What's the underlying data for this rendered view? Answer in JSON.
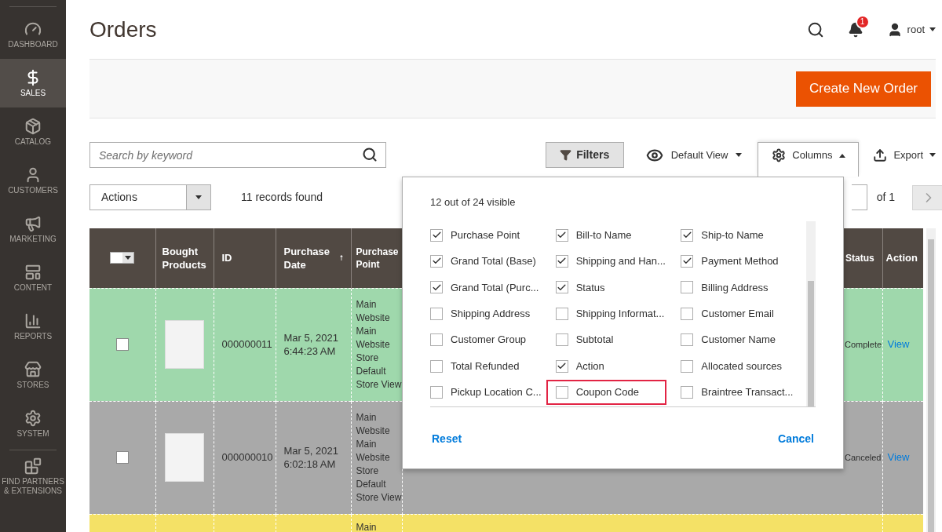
{
  "sidebar": {
    "items": [
      {
        "label": "DASHBOARD",
        "selected": false
      },
      {
        "label": "SALES",
        "selected": true
      },
      {
        "label": "CATALOG",
        "selected": false
      },
      {
        "label": "CUSTOMERS",
        "selected": false
      },
      {
        "label": "MARKETING",
        "selected": false
      },
      {
        "label": "CONTENT",
        "selected": false
      },
      {
        "label": "REPORTS",
        "selected": false
      },
      {
        "label": "STORES",
        "selected": false
      },
      {
        "label": "SYSTEM",
        "selected": false
      },
      {
        "label": "FIND PARTNERS & EXTENSIONS",
        "selected": false
      }
    ]
  },
  "page_title": "Orders",
  "header": {
    "notifications": "1",
    "user": "root"
  },
  "primary_button": "Create New Order",
  "search": {
    "placeholder": "Search by keyword"
  },
  "toolbar": {
    "filters": "Filters",
    "view": "Default View",
    "columns": "Columns",
    "columns_open": true,
    "export": "Export"
  },
  "actions_select": "Actions",
  "records_found": "11 records found",
  "pager": {
    "of": "of 1"
  },
  "columns_panel": {
    "summary": "12 out of 24 visible",
    "items": [
      {
        "label": "Purchase Point",
        "checked": true,
        "highlighted": false
      },
      {
        "label": "Bill-to Name",
        "checked": true,
        "highlighted": false
      },
      {
        "label": "Ship-to Name",
        "checked": true,
        "highlighted": false
      },
      {
        "label": "Grand Total (Base)",
        "checked": true,
        "highlighted": false
      },
      {
        "label": "Shipping and Han...",
        "checked": true,
        "highlighted": false
      },
      {
        "label": "Payment Method",
        "checked": true,
        "highlighted": false
      },
      {
        "label": "Grand Total (Purc...",
        "checked": true,
        "highlighted": false
      },
      {
        "label": "Status",
        "checked": true,
        "highlighted": false
      },
      {
        "label": "Billing Address",
        "checked": false,
        "highlighted": false
      },
      {
        "label": "Shipping Address",
        "checked": false,
        "highlighted": false
      },
      {
        "label": "Shipping Informat...",
        "checked": false,
        "highlighted": false
      },
      {
        "label": "Customer Email",
        "checked": false,
        "highlighted": false
      },
      {
        "label": "Customer Group",
        "checked": false,
        "highlighted": false
      },
      {
        "label": "Subtotal",
        "checked": false,
        "highlighted": false
      },
      {
        "label": "Customer Name",
        "checked": false,
        "highlighted": false
      },
      {
        "label": "Total Refunded",
        "checked": false,
        "highlighted": false
      },
      {
        "label": "Action",
        "checked": true,
        "highlighted": false
      },
      {
        "label": "Allocated sources",
        "checked": false,
        "highlighted": false
      },
      {
        "label": "Pickup Location C...",
        "checked": false,
        "highlighted": false
      },
      {
        "label": "Coupon Code",
        "checked": false,
        "highlighted": true
      },
      {
        "label": "Braintree Transact...",
        "checked": false,
        "highlighted": false
      }
    ],
    "reset": "Reset",
    "cancel": "Cancel"
  },
  "table": {
    "columns": [
      "Bought Products",
      "ID",
      "Purchase Date",
      "Purchase Point",
      "Status",
      "Action"
    ],
    "rows": [
      {
        "color": "#9fd8ac",
        "checked": false,
        "id": "000000011",
        "date": "Mar 5, 2021",
        "time": "6:44:23 AM",
        "purchase_point": [
          "Main",
          "Website",
          "Main",
          "Website",
          "Store",
          "Default",
          "Store View"
        ],
        "status": "Complete",
        "action": "View"
      },
      {
        "color": "#a9a9a9",
        "checked": false,
        "id": "000000010",
        "date": "Mar 5, 2021",
        "time": "6:02:18 AM",
        "purchase_point": [
          "Main",
          "Website",
          "Main",
          "Website",
          "Store",
          "Default",
          "Store View"
        ],
        "status": "Canceled",
        "action": "View"
      },
      {
        "color": "#f4e166",
        "purchase_point": [
          "Main"
        ]
      }
    ]
  }
}
